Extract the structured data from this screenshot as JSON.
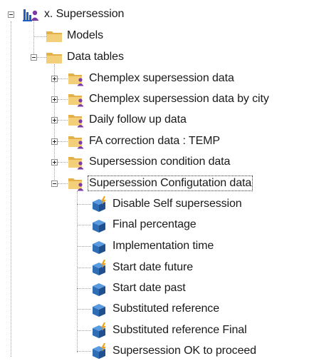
{
  "tree": {
    "root": {
      "label": "x. Supersession",
      "icon": "model-root-icon"
    },
    "models": {
      "label": "Models",
      "icon": "folder-icon"
    },
    "data_tables": {
      "label": "Data tables",
      "icon": "folder-icon",
      "children": [
        {
          "label": "Chemplex supersession data",
          "icon": "user-folder-icon",
          "state": "collapsed"
        },
        {
          "label": "Chemplex supersession data by city",
          "icon": "user-folder-icon",
          "state": "collapsed"
        },
        {
          "label": "Daily follow up data",
          "icon": "user-folder-icon",
          "state": "collapsed"
        },
        {
          "label": "FA correction data : TEMP",
          "icon": "user-folder-icon",
          "state": "collapsed"
        },
        {
          "label": "Supersession condition data",
          "icon": "user-folder-icon",
          "state": "collapsed"
        },
        {
          "label": "Supersession Configutation data",
          "icon": "user-folder-icon",
          "state": "expanded"
        }
      ]
    },
    "config_items": [
      {
        "label": "Disable Self supersession",
        "icon": "cube-flash-icon"
      },
      {
        "label": "Final percentage",
        "icon": "cube-icon"
      },
      {
        "label": "Implementation time",
        "icon": "cube-icon"
      },
      {
        "label": "Start date future",
        "icon": "cube-flash-icon"
      },
      {
        "label": "Start date past",
        "icon": "cube-icon"
      },
      {
        "label": "Substituted reference",
        "icon": "cube-icon"
      },
      {
        "label": "Substituted reference Final",
        "icon": "cube-flash-icon"
      },
      {
        "label": "Supersession OK to proceed",
        "icon": "cube-flash-icon"
      }
    ]
  },
  "colors": {
    "folder": "#e8b94a",
    "folder_light": "#f5d47e",
    "cube": "#2f6db5",
    "flash": "#f0a21c",
    "user": "#7a3aa8"
  }
}
